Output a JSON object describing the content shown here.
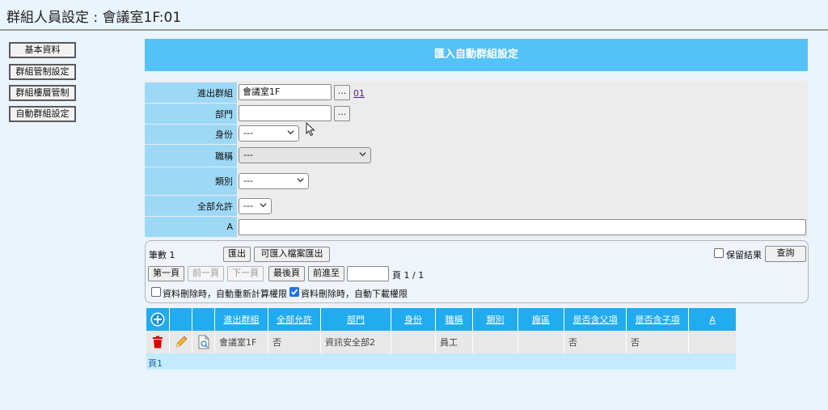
{
  "page": {
    "title": "群組人員設定 : 會議室1F:01"
  },
  "sidebar": {
    "buttons": [
      {
        "label": "基本資料"
      },
      {
        "label": "群組管制設定"
      },
      {
        "label": "群組樓層管制"
      },
      {
        "label": "自動群組設定"
      }
    ]
  },
  "header": {
    "title": "匯入自動群組設定"
  },
  "form": {
    "in_out_group": {
      "label": "進出群組",
      "value": "會議室1F",
      "button": "...",
      "link": "01"
    },
    "department": {
      "label": "部門",
      "value": "",
      "button": "..."
    },
    "identity": {
      "label": "身份",
      "selected": "---"
    },
    "job_title": {
      "label": "職稱",
      "selected": "---"
    },
    "category": {
      "label": "類別",
      "selected": "---"
    },
    "allow_all": {
      "label": "全部允許",
      "selected": "---"
    },
    "a_field": {
      "label": "A",
      "value": ""
    }
  },
  "controls": {
    "count_label": "筆數 1",
    "export_btn": "匯出",
    "export_importable_btn": "可匯入檔案匯出",
    "keep_results_label": "保留結果",
    "query_btn": "查詢",
    "first_page_btn": "第一頁",
    "prev_page_btn": "前一頁",
    "next_page_btn": "下一頁",
    "last_page_btn": "最後頁",
    "goto_btn": "前進至",
    "goto_value": "",
    "page_info": "頁 1 / 1",
    "option_recalc_label": "資料刪除時，自動重新計算權限",
    "option_recalc_checked": false,
    "option_download_label": "資料刪除時，自動下載權限",
    "option_download_checked": true
  },
  "table": {
    "columns": [
      "進出群組",
      "全部允許",
      "部門",
      "身份",
      "職稱",
      "類別",
      "廠區",
      "是否含父項",
      "是否含子項",
      "A"
    ],
    "rows": [
      {
        "cells": [
          "會議室1F",
          "否",
          "資訊安全部2",
          "",
          "員工",
          "",
          "",
          "否",
          "否",
          ""
        ]
      }
    ],
    "footer": "頁1"
  },
  "colors": {
    "header_bar": "#53c2f7",
    "label_bg": "#9dd9f7",
    "grid_header": "#20acef",
    "grid_footer": "#c4ebfd",
    "page_bg": "#eaf4fd"
  }
}
